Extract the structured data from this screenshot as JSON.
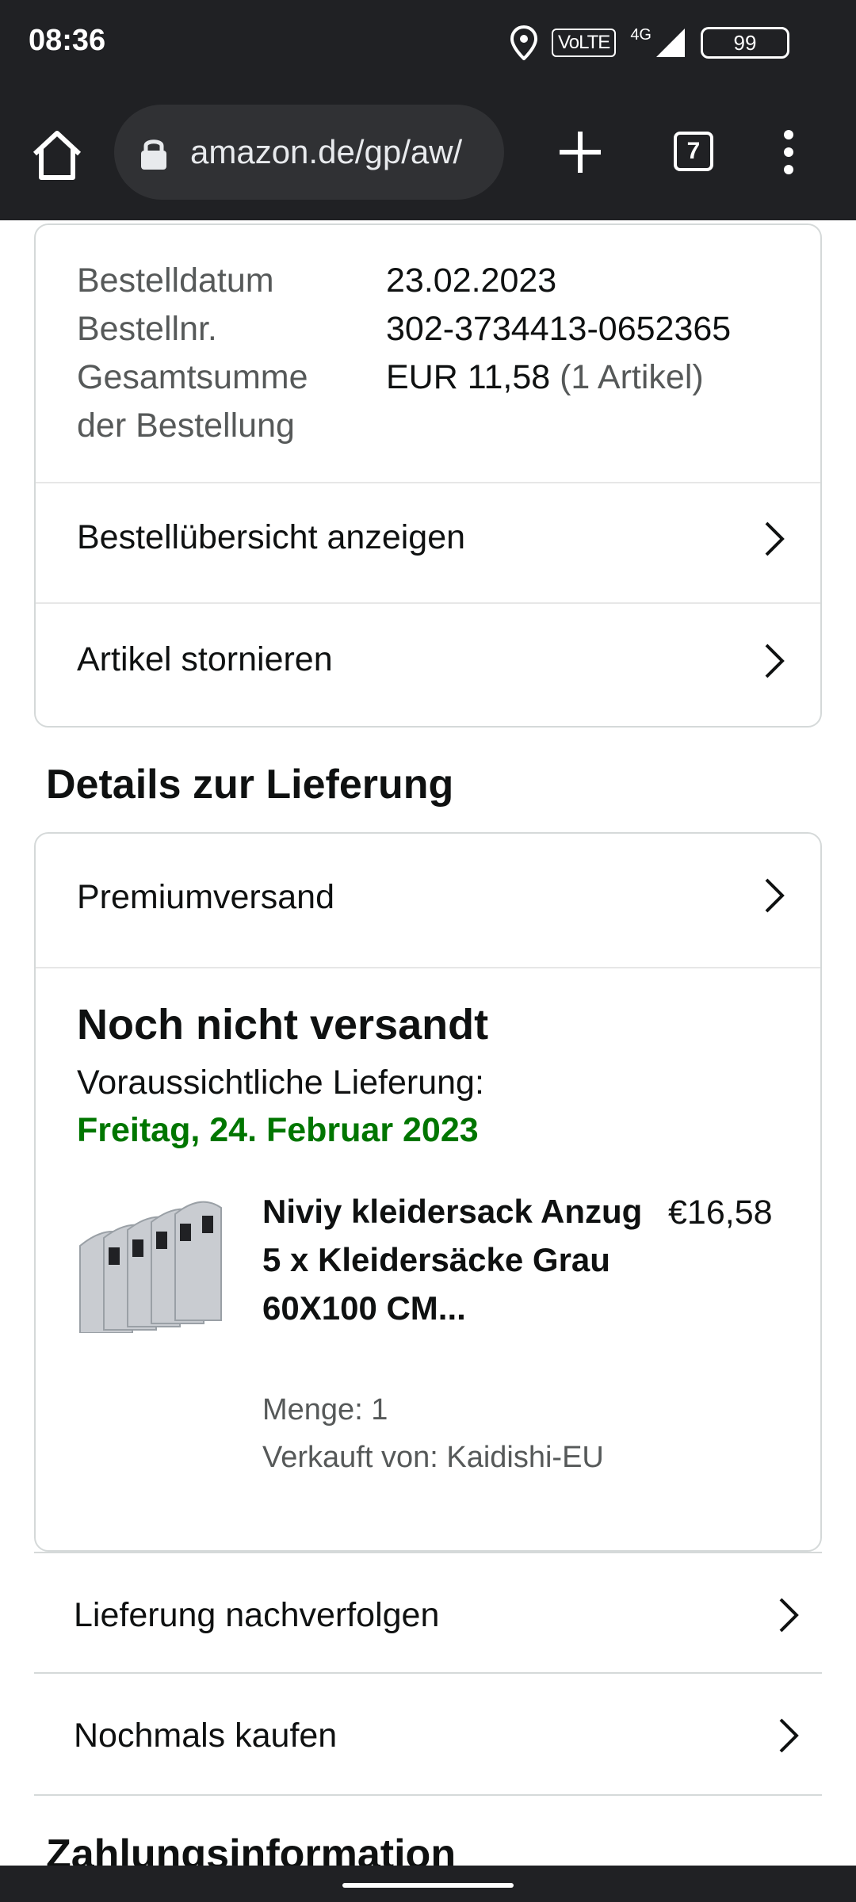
{
  "status_bar": {
    "time": "08:36",
    "volte": "VoLTE",
    "network": "4G",
    "battery": "99"
  },
  "browser": {
    "url": "amazon.de/gp/aw/",
    "tab_count": "7"
  },
  "order_summary": {
    "rows": [
      {
        "label": "Bestelldatum",
        "value": "23.02.2023"
      },
      {
        "label": "Bestellnr.",
        "value": "302-3734413-0652365"
      },
      {
        "label": "Gesamtsumme der Bestellung",
        "value": "EUR 11,58",
        "value_extra": "(1 Artikel)"
      }
    ],
    "view_summary_label": "Bestellübersicht anzeigen",
    "cancel_label": "Artikel stornieren"
  },
  "delivery": {
    "section_title": "Details zur Lieferung",
    "shipping_method": "Premiumversand",
    "status": "Noch nicht versandt",
    "eta_label": "Voraussichtliche Lieferung:",
    "eta_date": "Freitag, 24. Februar 2023",
    "eta_color": "#007600",
    "item": {
      "title": "Niviy kleidersack Anzug 5 x Kleidersäcke Grau 60X100 CM...",
      "price": "€16,58",
      "quantity": "Menge: 1",
      "seller": "Verkauft von: Kaidishi-EU"
    },
    "track_label": "Lieferung nachverfolgen",
    "buy_again_label": "Nochmals kaufen"
  },
  "payment": {
    "section_title": "Zahlungsinformation"
  }
}
